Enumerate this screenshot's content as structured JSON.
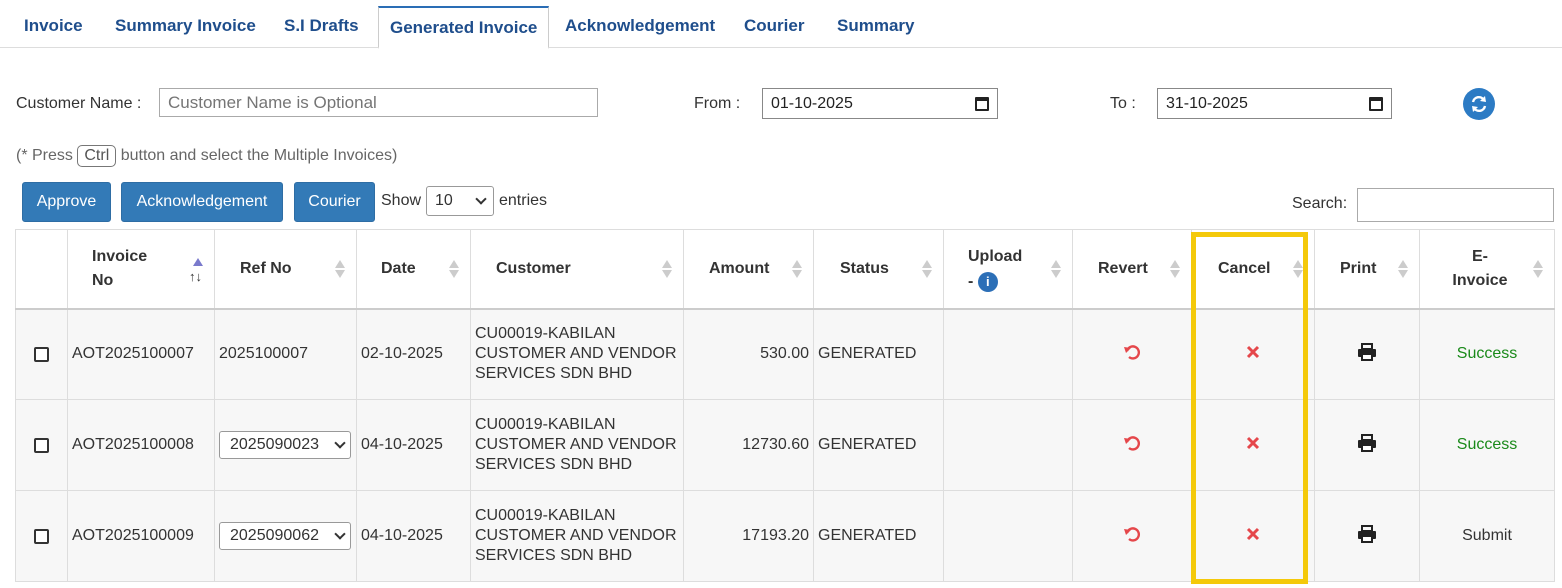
{
  "tabs": [
    "Invoice",
    "Summary Invoice",
    "S.I Drafts",
    "Generated Invoice",
    "Acknowledgement",
    "Courier",
    "Summary"
  ],
  "filters": {
    "customer_label": "Customer Name :",
    "customer_value": "Customer Name is Optional",
    "from_label": "From :",
    "from_value": "01-10-2025",
    "to_label": "To :",
    "to_value": "31-10-2025"
  },
  "note": {
    "prefix": "(* Press",
    "key": "Ctrl",
    "suffix": "button and select the Multiple Invoices)"
  },
  "toolbar": {
    "approve": "Approve",
    "acknowledgement": "Acknowledgement",
    "courier": "Courier",
    "show_label": "Show",
    "entries_value": "10",
    "entries_label": "entries",
    "search_label": "Search:"
  },
  "table": {
    "headers": {
      "invoice_no": "Invoice No",
      "ref_no": "Ref No",
      "date": "Date",
      "customer": "Customer",
      "amount": "Amount",
      "status": "Status",
      "upload": "Upload -",
      "revert": "Revert",
      "cancel": "Cancel",
      "print": "Print",
      "einvoice": "E-Invoice"
    },
    "rows": [
      {
        "invoice_no": "AOT2025100007",
        "ref_no": "2025100007",
        "ref_select": false,
        "date": "02-10-2025",
        "customer": "CU00019-KABILAN CUSTOMER AND VENDOR SERVICES SDN BHD",
        "amount": "530.00",
        "status": "GENERATED",
        "einvoice": "Success"
      },
      {
        "invoice_no": "AOT2025100008",
        "ref_no": "2025090023",
        "ref_select": true,
        "date": "04-10-2025",
        "customer": "CU00019-KABILAN CUSTOMER AND VENDOR SERVICES SDN BHD",
        "amount": "12730.60",
        "status": "GENERATED",
        "einvoice": "Success"
      },
      {
        "invoice_no": "AOT2025100009",
        "ref_no": "2025090062",
        "ref_select": true,
        "date": "04-10-2025",
        "customer": "CU00019-KABILAN CUSTOMER AND VENDOR SERVICES SDN BHD",
        "amount": "17193.20",
        "status": "GENERATED",
        "einvoice": "Submit"
      }
    ]
  },
  "colors": {
    "accent": "#337ab7",
    "highlight": "#f4c90a",
    "cancel": "#e5474b",
    "success": "#1a8a1a"
  }
}
